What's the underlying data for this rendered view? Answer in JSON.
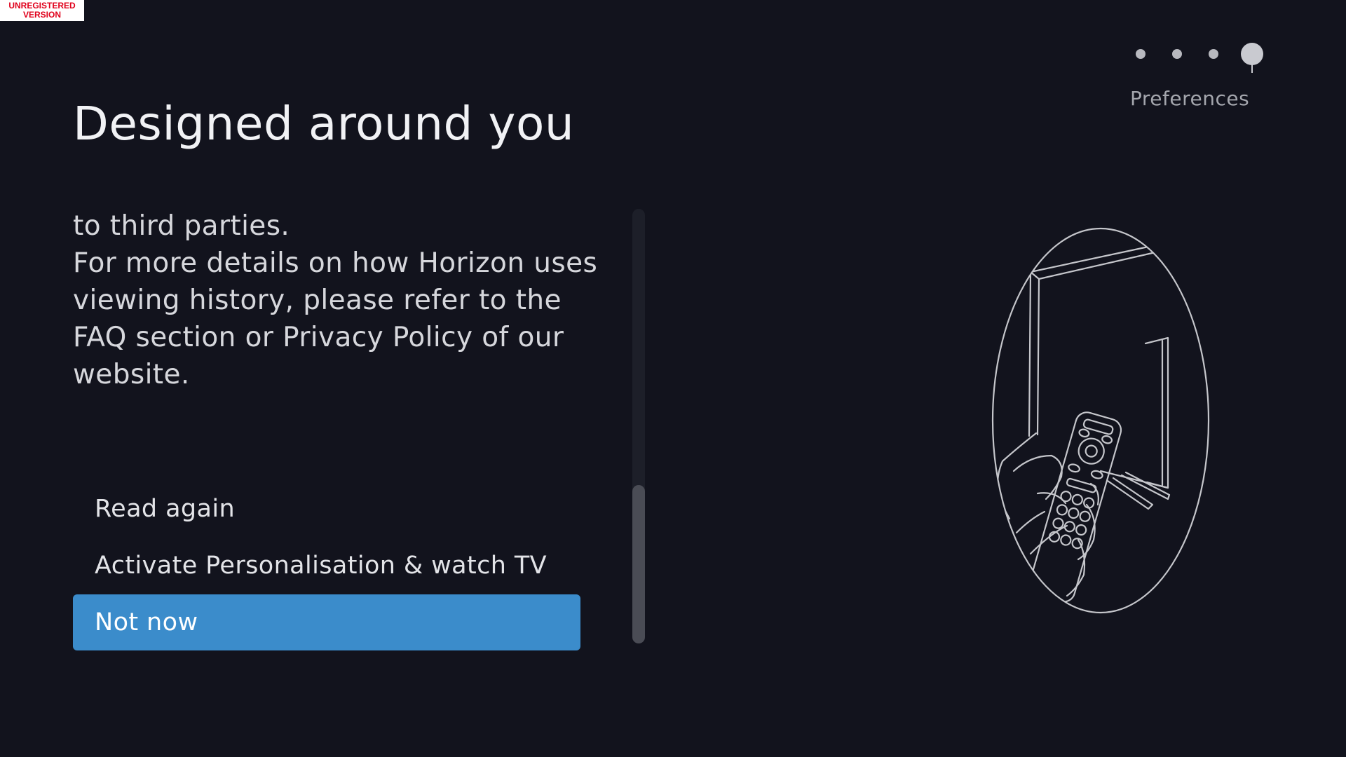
{
  "watermark": {
    "line1": "UNREGISTERED",
    "line2": "VERSION"
  },
  "page": {
    "title": "Designed around you"
  },
  "stepper": {
    "label": "Preferences",
    "total_steps": 4,
    "current_step": 4
  },
  "content": {
    "lines": [
      "to third parties.",
      "For more details on how Horizon uses",
      "viewing history, please refer to the",
      "FAQ section or Privacy Policy of our",
      "website."
    ]
  },
  "scrollbar": {
    "position_fraction": 1.0
  },
  "menu": {
    "items": [
      {
        "label": "Read again",
        "selected": false
      },
      {
        "label": "Activate Personalisation & watch TV",
        "selected": false
      },
      {
        "label": "Not now",
        "selected": true
      }
    ]
  },
  "colors": {
    "background": "#12131d",
    "accent": "#3b8ccb"
  },
  "illustration": {
    "icon": "tv-remote-illustration-icon"
  }
}
